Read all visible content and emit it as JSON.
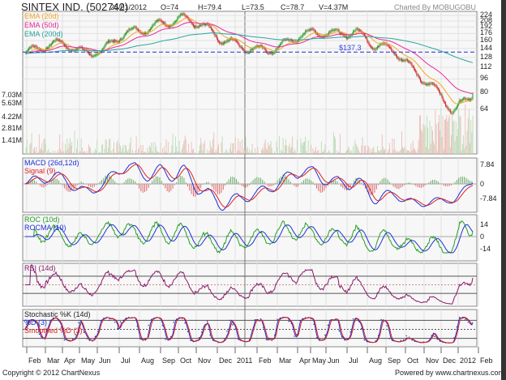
{
  "header": {
    "title": "SINTEX IND. (502742)",
    "date": "25/01/2012",
    "open": "O=74",
    "high": "H=79.4",
    "low": "L=73.5",
    "close": "C=78.7",
    "volume": "V=4.37M",
    "credit": "Charted By MOBUGOBU"
  },
  "footer": {
    "copyright": "Copyright © 2012 ChartNexus",
    "powered": "Powered by www.chartnexus.com"
  },
  "colors": {
    "ema20": "#f5a623",
    "ema50": "#e8289a",
    "ema200": "#2aa5a0",
    "up": "#1a9a1a",
    "down": "#cc2222",
    "macd": "#1f2fd6",
    "signal": "#e02020",
    "roc": "#22a022",
    "rocma": "#1f2fd6",
    "rsi": "#8a1a6a",
    "support": "#3344dd"
  },
  "chart_data": [
    {
      "type": "candlestick",
      "title": "SINTEX IND. (502742)",
      "legend": [
        "EMA (20d)",
        "EMA (50d)",
        "EMA (200d)"
      ],
      "support_label": "$137.3",
      "support_value": 137.3,
      "price_ticks": [
        "224",
        "208",
        "192",
        "176",
        "160",
        "144",
        "128",
        "112",
        "96",
        "80",
        "64"
      ],
      "volume_ticks": [
        "7.03M",
        "5.63M",
        "4.22M",
        "2.81M",
        "1.41M"
      ],
      "x_labels": [
        "Feb",
        "Mar",
        "Apr",
        "May",
        "Jun",
        "Jul",
        "Aug",
        "Sep",
        "Oct",
        "Nov",
        "Dec",
        "2011",
        "Feb",
        "Mar",
        "Apr",
        "May",
        "Jun",
        "Jul",
        "Aug",
        "Sep",
        "Oct",
        "Nov",
        "Dec",
        "2012",
        "Feb"
      ],
      "monthly_close": [
        135,
        150,
        155,
        135,
        140,
        175,
        185,
        200,
        215,
        200,
        165,
        150,
        140,
        145,
        170,
        180,
        175,
        180,
        150,
        140,
        105,
        85,
        62,
        78.7
      ],
      "ylim": [
        64,
        224
      ]
    },
    {
      "type": "line",
      "title": "MACD",
      "legend": [
        "MACD (26d,12d)",
        "Signal (9)"
      ],
      "ticks": [
        "7.84",
        "0",
        "-7.84"
      ]
    },
    {
      "type": "line",
      "title": "ROC",
      "legend": [
        "ROC (10d)",
        "ROCMA (10)"
      ],
      "ticks": [
        "14",
        "0",
        "-14"
      ]
    },
    {
      "type": "line",
      "title": "RSI",
      "legend": [
        "RSI (14d)"
      ]
    },
    {
      "type": "line",
      "title": "Stochastic",
      "legend": [
        "Stochastic %K (14d)",
        "%D (3)",
        "Smoothed %D (3)"
      ]
    }
  ]
}
